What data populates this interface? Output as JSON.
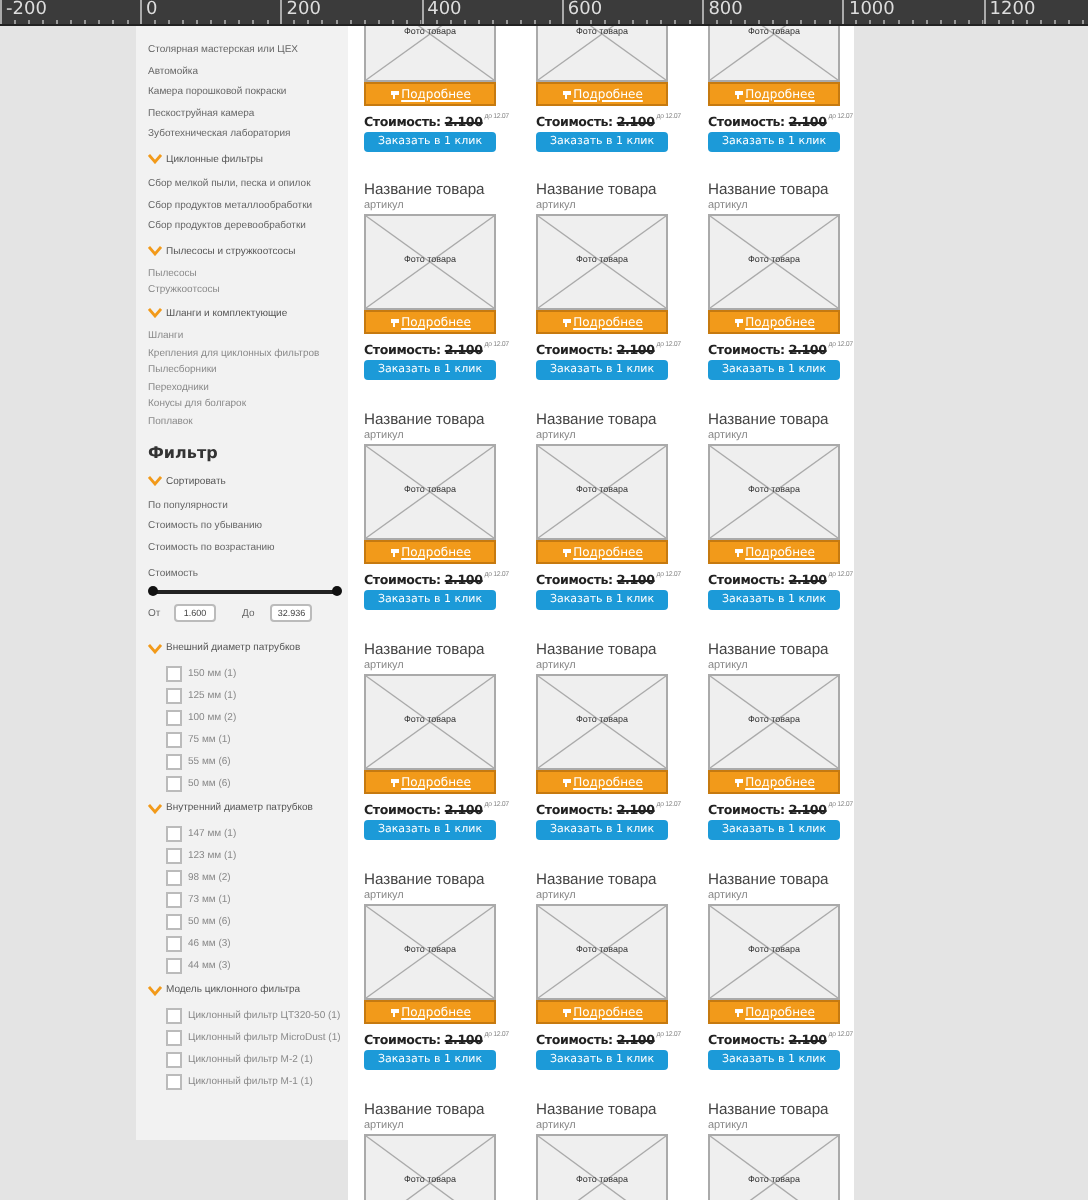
{
  "ruler": {
    "labels": [
      "-200",
      "0",
      "200",
      "400",
      "600",
      "800",
      "1000",
      "1200"
    ]
  },
  "sidebar": {
    "items": [
      {
        "kind": "link",
        "label": "Столярная мастерская или ЦЕХ"
      },
      {
        "kind": "link",
        "label": "Автомойка"
      },
      {
        "kind": "link",
        "label": "Камера порошковой покраски"
      },
      {
        "kind": "link",
        "label": "Пескоструйная камера"
      },
      {
        "kind": "link",
        "label": "Зуботехническая лаборатория"
      },
      {
        "kind": "section",
        "label": "Циклонные фильтры",
        "expanded": true
      },
      {
        "kind": "link",
        "label": "Сбор мелкой пыли, песка и опилок"
      },
      {
        "kind": "link",
        "label": "Сбор продуктов металлообработки"
      },
      {
        "kind": "link",
        "label": "Сбор продуктов деревообработки"
      },
      {
        "kind": "section",
        "label": "Пылесосы и стружкоотсосы",
        "expanded": true
      },
      {
        "kind": "sublink",
        "label": "Пылесосы"
      },
      {
        "kind": "sublink",
        "label": "Стружкоотсосы"
      },
      {
        "kind": "section",
        "label": "Шланги и комплектующие",
        "expanded": true
      },
      {
        "kind": "sublink",
        "label": "Шланги"
      },
      {
        "kind": "sublink",
        "label": "Крепления для циклонных фильтров"
      },
      {
        "kind": "sublink",
        "label": "Пылесборники"
      },
      {
        "kind": "sublink",
        "label": "Переходники"
      },
      {
        "kind": "sublink",
        "label": "Конусы для болгарок"
      },
      {
        "kind": "sublink",
        "label": "Поплавок"
      },
      {
        "kind": "heading",
        "label": "Фильтр"
      },
      {
        "kind": "section",
        "label": "Сортировать",
        "expanded": true
      },
      {
        "kind": "link",
        "label": "По популярности"
      },
      {
        "kind": "link",
        "label": "Стоимость по убыванию"
      },
      {
        "kind": "link",
        "label": "Стоимость по возрастанию"
      },
      {
        "kind": "label",
        "label": "Стоимость"
      },
      {
        "kind": "slider",
        "level": 1
      },
      {
        "kind": "range",
        "from_label": "От",
        "from_value": "1.600",
        "to_label": "До",
        "to_value": "32.936"
      },
      {
        "kind": "section",
        "label": "Внешний диаметр патрубков",
        "expanded": true
      },
      {
        "kind": "checkbox",
        "label": "150 мм (1)",
        "checked": false
      },
      {
        "kind": "checkbox",
        "label": "125 мм (1)",
        "checked": false
      },
      {
        "kind": "checkbox",
        "label": "100 мм (2)",
        "checked": false
      },
      {
        "kind": "checkbox",
        "label": "75 мм (1)",
        "checked": false
      },
      {
        "kind": "checkbox",
        "label": "55 мм (6)",
        "checked": false
      },
      {
        "kind": "checkbox",
        "label": "50 мм (6)",
        "checked": false
      },
      {
        "kind": "section",
        "label": "Внутренний диаметр патрубков",
        "expanded": true
      },
      {
        "kind": "checkbox",
        "label": "147 мм (1)",
        "checked": false
      },
      {
        "kind": "checkbox",
        "label": "123 мм (1)",
        "checked": false
      },
      {
        "kind": "checkbox",
        "label": "98 мм (2)",
        "checked": false
      },
      {
        "kind": "checkbox",
        "label": "73 мм (1)",
        "checked": false
      },
      {
        "kind": "checkbox",
        "label": "50 мм (6)",
        "checked": false
      },
      {
        "kind": "checkbox",
        "label": "46 мм (3)",
        "checked": false
      },
      {
        "kind": "checkbox",
        "label": "44 мм (3)",
        "checked": false
      },
      {
        "kind": "section",
        "label": "Модель циклонного фильтра",
        "expanded": true
      },
      {
        "kind": "checkbox",
        "label": "Циклонный фильтр ЦТ320-50 (1)",
        "checked": false
      },
      {
        "kind": "checkbox",
        "label": "Циклонный фильтр MicroDust (1)",
        "checked": false
      },
      {
        "kind": "checkbox",
        "label": "Циклонный фильтр М-2 (1)",
        "checked": false
      },
      {
        "kind": "checkbox",
        "label": "Циклонный фильтр М-1 (1)",
        "checked": false
      }
    ]
  },
  "products": [
    {
      "kind": "cut_top",
      "photo": "Фото товара",
      "details": "Подробнее",
      "price_label": "Стоимость:",
      "price": "2.100",
      "price_date": "до 12.07",
      "order": "Заказать в 1 клик"
    },
    {
      "kind": "cut_top",
      "photo": "Фото товара",
      "details": "Подробнее",
      "price_label": "Стоимость:",
      "price": "2.100",
      "price_date": "до 12.07",
      "order": "Заказать в 1 клик"
    },
    {
      "kind": "cut_top",
      "photo": "Фото товара",
      "details": "Подробнее",
      "price_label": "Стоимость:",
      "price": "2.100",
      "price_date": "до 12.07",
      "order": "Заказать в 1 клик"
    },
    {
      "kind": "full",
      "title": "Название товара",
      "article": "артикул",
      "photo": "Фото товара",
      "details": "Подробнее",
      "price_label": "Стоимость:",
      "price": "2.100",
      "price_date": "до 12.07",
      "order": "Заказать в 1 клик"
    },
    {
      "kind": "full",
      "title": "Название товара",
      "article": "артикул",
      "photo": "Фото товара",
      "details": "Подробнее",
      "price_label": "Стоимость:",
      "price": "2.100",
      "price_date": "до 12.07",
      "order": "Заказать в 1 клик"
    },
    {
      "kind": "full",
      "title": "Название товара",
      "article": "артикул",
      "photo": "Фото товара",
      "details": "Подробнее",
      "price_label": "Стоимость:",
      "price": "2.100",
      "price_date": "до 12.07",
      "order": "Заказать в 1 клик"
    },
    {
      "kind": "full",
      "title": "Название товара",
      "article": "артикул",
      "photo": "Фото товара",
      "details": "Подробнее",
      "price_label": "Стоимость:",
      "price": "2.100",
      "price_date": "до 12.07",
      "order": "Заказать в 1 клик"
    },
    {
      "kind": "full",
      "title": "Название товара",
      "article": "артикул",
      "photo": "Фото товара",
      "details": "Подробнее",
      "price_label": "Стоимость:",
      "price": "2.100",
      "price_date": "до 12.07",
      "order": "Заказать в 1 клик"
    },
    {
      "kind": "full",
      "title": "Название товара",
      "article": "артикул",
      "photo": "Фото товара",
      "details": "Подробнее",
      "price_label": "Стоимость:",
      "price": "2.100",
      "price_date": "до 12.07",
      "order": "Заказать в 1 клик"
    },
    {
      "kind": "full",
      "title": "Название товара",
      "article": "артикул",
      "photo": "Фото товара",
      "details": "Подробнее",
      "price_label": "Стоимость:",
      "price": "2.100",
      "price_date": "до 12.07",
      "order": "Заказать в 1 клик"
    },
    {
      "kind": "full",
      "title": "Название товара",
      "article": "артикул",
      "photo": "Фото товара",
      "details": "Подробнее",
      "price_label": "Стоимость:",
      "price": "2.100",
      "price_date": "до 12.07",
      "order": "Заказать в 1 клик"
    },
    {
      "kind": "full",
      "title": "Название товара",
      "article": "артикул",
      "photo": "Фото товара",
      "details": "Подробнее",
      "price_label": "Стоимость:",
      "price": "2.100",
      "price_date": "до 12.07",
      "order": "Заказать в 1 клик"
    },
    {
      "kind": "full",
      "title": "Название товара",
      "article": "артикул",
      "photo": "Фото товара",
      "details": "Подробнее",
      "price_label": "Стоимость:",
      "price": "2.100",
      "price_date": "до 12.07",
      "order": "Заказать в 1 клик"
    },
    {
      "kind": "full",
      "title": "Название товара",
      "article": "артикул",
      "photo": "Фото товара",
      "details": "Подробнее",
      "price_label": "Стоимость:",
      "price": "2.100",
      "price_date": "до 12.07",
      "order": "Заказать в 1 клик"
    },
    {
      "kind": "full",
      "title": "Название товара",
      "article": "артикул",
      "photo": "Фото товара",
      "details": "Подробнее",
      "price_label": "Стоимость:",
      "price": "2.100",
      "price_date": "до 12.07",
      "order": "Заказать в 1 клик"
    },
    {
      "kind": "cut_bottom",
      "title": "Название товара",
      "article": "артикул",
      "photo": "Фото товара"
    },
    {
      "kind": "cut_bottom",
      "title": "Название товара",
      "article": "артикул",
      "photo": "Фото товара"
    },
    {
      "kind": "cut_bottom",
      "title": "Название товара",
      "article": "артикул",
      "photo": "Фото товара"
    }
  ]
}
